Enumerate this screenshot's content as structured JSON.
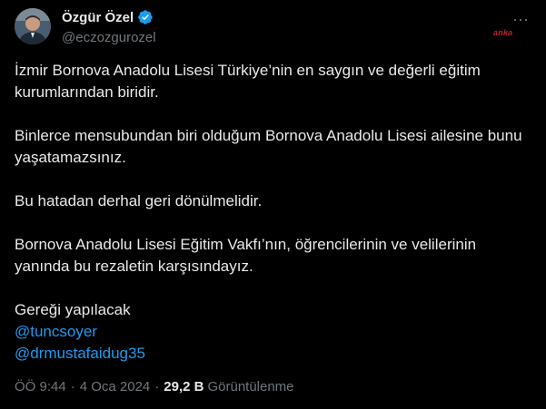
{
  "author": {
    "name": "Özgür Özel",
    "handle": "@eczozgurozel",
    "verified": true,
    "avatar_icon": "profile-photo"
  },
  "watermark": "anka",
  "more_icon": "more-horizontal-icon",
  "tweet": {
    "paragraphs": [
      "İzmir Bornova Anadolu Lisesi Türkiye’nin en saygın ve değerli eğitim kurumlarından biridir.",
      "Binlerce mensubundan biri olduğum Bornova Anadolu Lisesi ailesine bunu yaşatamazsınız.",
      "Bu hatadan derhal geri dönülmelidir.",
      "Bornova Anadolu Lisesi Eğitim Vakfı’nın, öğrencilerinin ve velilerinin yanında bu rezaletin karşısındayız."
    ],
    "closing": "Gereği yapılacak",
    "mentions": [
      "@tuncsoyer",
      "@drmustafaidug35"
    ]
  },
  "meta": {
    "time": "ÖÖ 9:44",
    "separator": "·",
    "date": "4 Oca 2024",
    "views_count": "29,2 B",
    "views_label": "Görüntülenme"
  },
  "colors": {
    "background": "#000000",
    "text": "#e7e9ea",
    "secondary": "#71767b",
    "link": "#1d9bf0",
    "verified": "#1d9bf0",
    "watermark": "#c4202f"
  }
}
